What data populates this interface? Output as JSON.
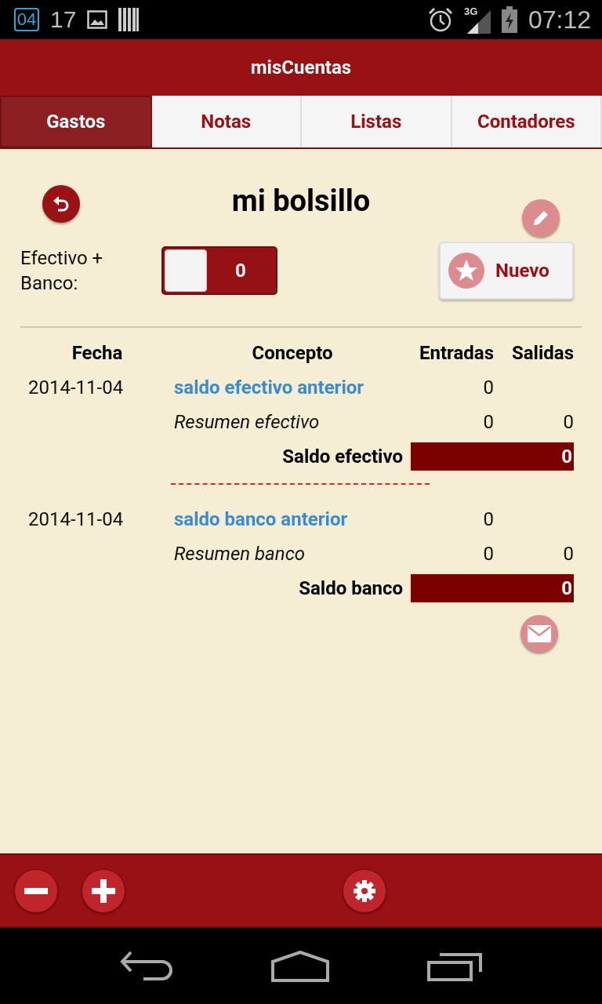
{
  "status_bar": {
    "calendar_day": "04",
    "notification_count": "17",
    "time": "07:12",
    "network": "3G"
  },
  "app_bar": {
    "title": "misCuentas"
  },
  "tabs": [
    {
      "label": "Gastos",
      "selected": true
    },
    {
      "label": "Notas",
      "selected": false
    },
    {
      "label": "Listas",
      "selected": false
    },
    {
      "label": "Contadores",
      "selected": false
    }
  ],
  "account": {
    "title": "mi bolsillo"
  },
  "toggle": {
    "label": "Efectivo + Banco:",
    "value": "0",
    "on": false
  },
  "new_button": {
    "label": "Nuevo"
  },
  "table": {
    "columns": [
      "Fecha",
      "Concepto",
      "Entradas",
      "Salidas"
    ],
    "groups": [
      {
        "date": "2014-11-04",
        "concept": "saldo efectivo anterior",
        "income": "0",
        "summary": "Resumen efectivo",
        "summary_income": "0",
        "summary_expense": "0",
        "balance_label": "Saldo efectivo",
        "balance": "0"
      },
      {
        "date": "2014-11-04",
        "concept": "saldo banco anterior",
        "income": "0",
        "summary": "Resumen banco",
        "summary_income": "0",
        "summary_expense": "0",
        "balance_label": "Saldo banco",
        "balance": "0"
      }
    ]
  }
}
